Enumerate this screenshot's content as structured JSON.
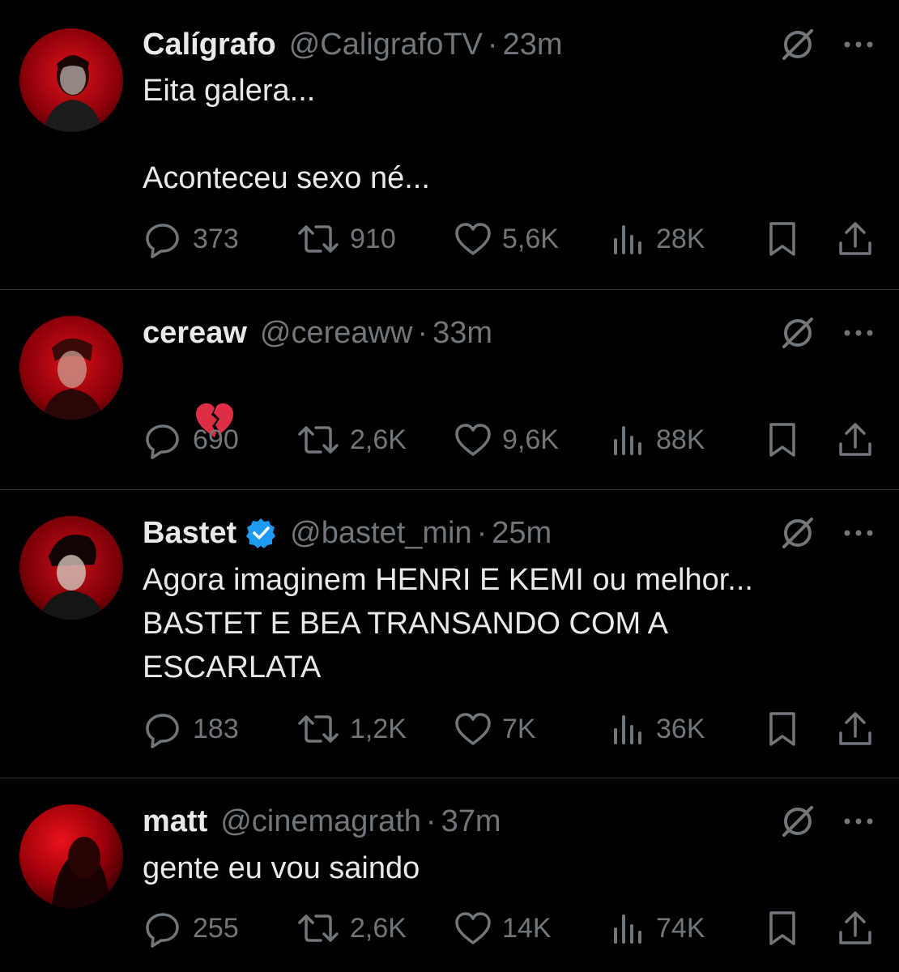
{
  "tweets": [
    {
      "name": "Calígrafo",
      "verified": false,
      "handle": "@CaligrafoTV",
      "separator": "·",
      "time": "23m",
      "text": "Eita galera...\n\nAconteceu sexo né...",
      "replies": "373",
      "reposts": "910",
      "likes": "5,6K",
      "views": "28K"
    },
    {
      "name": "cereaw",
      "verified": false,
      "handle": "@cereaww",
      "separator": "·",
      "time": "33m",
      "text": "",
      "emoji": "broken-heart",
      "replies": "690",
      "reposts": "2,6K",
      "likes": "9,6K",
      "views": "88K"
    },
    {
      "name": "Bastet",
      "verified": true,
      "handle": "@bastet_min",
      "separator": "·",
      "time": "25m",
      "text": "Agora imaginem HENRI E KEMI ou melhor...\nBASTET E BEA TRANSANDO COM A\nESCARLATA",
      "replies": "183",
      "reposts": "1,2K",
      "likes": "7K",
      "views": "36K"
    },
    {
      "name": "matt",
      "verified": false,
      "handle": "@cinemagrath",
      "separator": "·",
      "time": "37m",
      "text": "gente eu vou saindo",
      "replies": "255",
      "reposts": "2,6K",
      "likes": "14K",
      "views": "74K"
    }
  ],
  "icons": {
    "reply": "reply-icon",
    "repost": "repost-icon",
    "like": "heart-icon",
    "views": "views-icon",
    "bookmark": "bookmark-icon",
    "share": "share-icon",
    "grok": "grok-icon",
    "more": "more-icon",
    "verified": "verified-badge-icon"
  },
  "colors": {
    "background": "#000000",
    "text": "#e7e9ea",
    "muted": "#71767b",
    "divider": "#2f3336",
    "verified": "#1d9bf0",
    "avatar_red": "#c4000a"
  }
}
